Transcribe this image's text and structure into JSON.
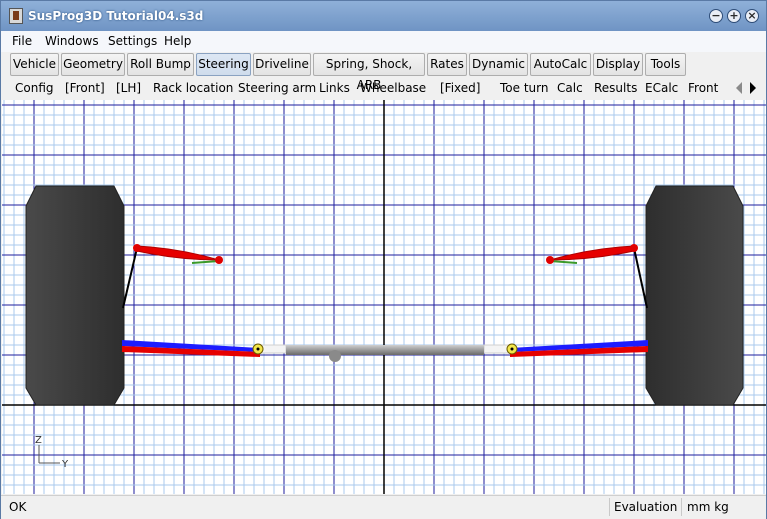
{
  "window": {
    "title": "SusProg3D Tutorial04.s3d"
  },
  "menu": [
    "File",
    "Windows",
    "Settings",
    "Help"
  ],
  "tabs": [
    {
      "label": "Vehicle"
    },
    {
      "label": "Geometry"
    },
    {
      "label": "Roll Bump"
    },
    {
      "label": "Steering",
      "active": true
    },
    {
      "label": "Driveline"
    },
    {
      "label": "Spring, Shock, ARB"
    },
    {
      "label": "Rates"
    },
    {
      "label": "Dynamic"
    },
    {
      "label": "AutoCalc"
    },
    {
      "label": "Display"
    },
    {
      "label": "Tools"
    }
  ],
  "subtabs": [
    "Config",
    "[Front]",
    "[LH]",
    "Rack location",
    "Steering arm",
    "Links",
    "Wheelbase",
    "[Fixed]",
    "Toe turn",
    "Calc",
    "Results",
    "ECalc",
    "Front"
  ],
  "axis": {
    "z": "Z",
    "y": "Y"
  },
  "status": {
    "left": "OK",
    "mode": "Evaluation",
    "units": "mm kg"
  },
  "colors": {
    "upper_arm": "#e60000",
    "lower_arm_front": "#1c1cff",
    "rack": "#9a9a9a",
    "tire": "#3a3a3a",
    "grid_major": "#1c1c9e",
    "grid_minor": "#a9c9ec"
  }
}
